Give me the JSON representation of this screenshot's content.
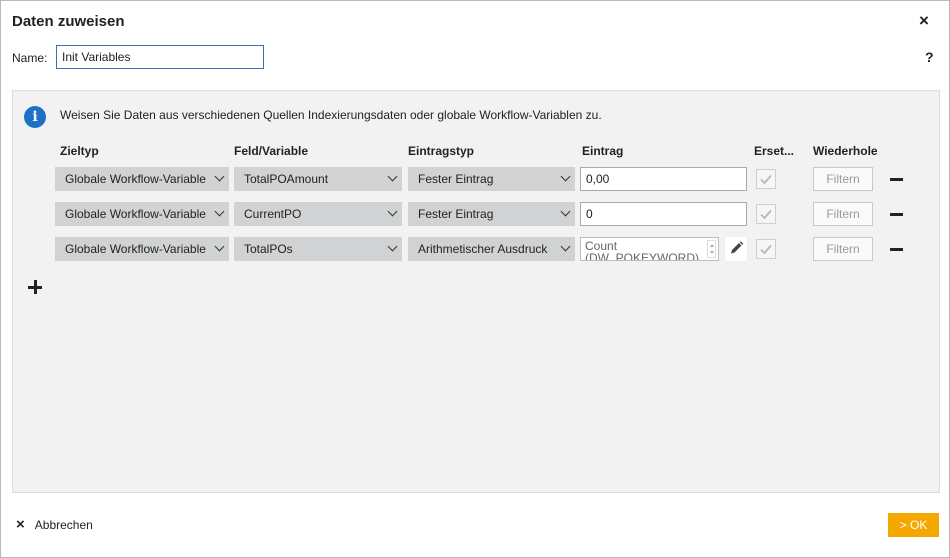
{
  "dialog": {
    "title": "Daten zuweisen",
    "close_icon": "×",
    "help_icon": "?"
  },
  "name_field": {
    "label": "Name:",
    "value": "Init Variables"
  },
  "info": {
    "icon": "i",
    "text": "Weisen Sie Daten aus verschiedenen Quellen Indexierungsdaten oder globale Workflow-Variablen zu."
  },
  "columns": {
    "zieltyp": "Zieltyp",
    "feld": "Feld/Variable",
    "eintragstyp": "Eintragstyp",
    "eintrag": "Eintrag",
    "ersetzen": "Erset...",
    "wiederholen": "Wiederholen"
  },
  "rows": [
    {
      "zieltyp": "Globale Workflow-Variable",
      "feld": "TotalPOAmount",
      "eintragstyp": "Fester Eintrag",
      "eintrag": "0,00",
      "filter": "Filtern"
    },
    {
      "zieltyp": "Globale Workflow-Variable",
      "feld": "CurrentPO",
      "eintragstyp": "Fester Eintrag",
      "eintrag": "0",
      "filter": "Filtern"
    },
    {
      "zieltyp": "Globale Workflow-Variable",
      "feld": "TotalPOs",
      "eintragstyp": "Arithmetischer Ausdruck",
      "eintrag": "Count (DW_POKEYWORD)",
      "filter": "Filtern"
    }
  ],
  "footer": {
    "cancel_label": "Abbrechen",
    "ok_label": "> OK"
  },
  "colors": {
    "accent": "#f5a800",
    "info_blue": "#1d72c8",
    "select_bg": "#d0d2d3"
  }
}
